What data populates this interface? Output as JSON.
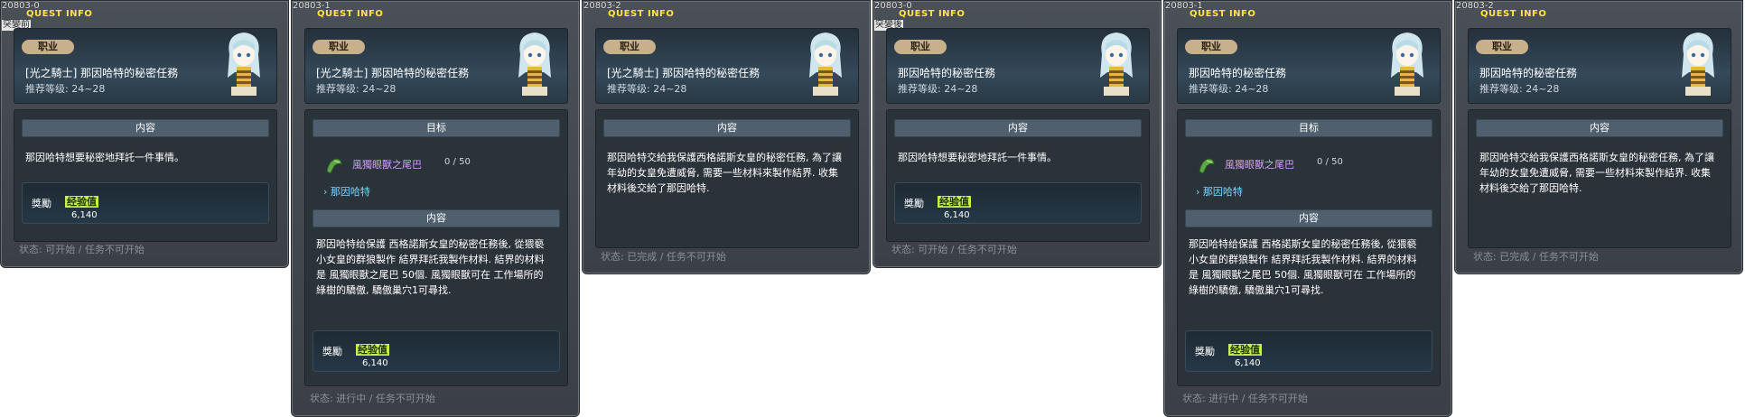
{
  "panels": [
    {
      "id": "20803-0",
      "title": "QUEST INFO",
      "sub_label": "突變前",
      "job_tag": "职业",
      "quest_name": "[光之騎士] 那因哈特的秘密任務",
      "level": "推荐等级: 24~28",
      "section_label": "内容",
      "description": "那因哈特想要秘密地拜託一件事情。",
      "reward_label": "獎勵",
      "reward_exp": "经验值",
      "reward_value": "6,140",
      "status": "状态: 可开始 / 任务不可开始"
    },
    {
      "id": "20803-1",
      "title": "QUEST INFO",
      "job_tag": "职业",
      "quest_name": "[光之騎士] 那因哈特的秘密任務",
      "level": "推荐等级: 24~28",
      "target_label": "目标",
      "target_item": "風獨眼獸之尾巴",
      "target_count": "0 / 50",
      "target_npc": "› 那因哈特",
      "section_label": "内容",
      "description": "那因哈特给保護 西格諾斯女皇的秘密任務後, 從猥褻小女皇的群狼製作 結界拜託我製作材料. 結界的材料是 風獨眼獸之尾巴 50個. 風獨眼獸可在 工作場所的 綠樹的驕傲, 驕傲巢穴1可尋找.",
      "reward_label": "獎勵",
      "reward_exp": "经验值",
      "reward_value": "6,140",
      "status": "状态: 进行中 / 任务不可开始"
    },
    {
      "id": "20803-2",
      "title": "QUEST INFO",
      "job_tag": "职业",
      "quest_name": "[光之騎士] 那因哈特的秘密任務",
      "level": "推荐等级: 24~28",
      "section_label": "内容",
      "description": "那因哈特交給我保護西格諾斯女皇的秘密任務, 為了讓年幼的女皇免遭威脅, 需要一些材料來製作結界. 收集材料後交給了那因哈特.",
      "status": "状态: 已完成 / 任务不可开始"
    },
    {
      "id": "20803-0",
      "title": "QUEST INFO",
      "sub_label": "突變後",
      "job_tag": "职业",
      "quest_name": "那因哈特的秘密任務",
      "level": "推荐等级: 24~28",
      "section_label": "内容",
      "description": "那因哈特想要秘密地拜託一件事情。",
      "reward_label": "獎勵",
      "reward_exp": "经验值",
      "reward_value": "6,140",
      "status": "状态: 可开始 / 任务不可开始"
    },
    {
      "id": "20803-1",
      "title": "QUEST INFO",
      "job_tag": "职业",
      "quest_name": "那因哈特的秘密任務",
      "level": "推荐等级: 24~28",
      "target_label": "目标",
      "target_item": "風獨眼獸之尾巴",
      "target_count": "0 / 50",
      "target_npc": "› 那因哈特",
      "section_label": "内容",
      "description": "那因哈特给保護 西格諾斯女皇的秘密任務後, 從猥褻小女皇的群狼製作 結界拜託我製作材料. 結界的材料是 風獨眼獸之尾巴 50個. 風獨眼獸可在 工作場所的 綠樹的驕傲, 驕傲巢穴1可尋找.",
      "reward_label": "獎勵",
      "reward_exp": "经验值",
      "reward_value": "6,140",
      "status": "状态: 进行中 / 任务不可开始"
    },
    {
      "id": "20803-2",
      "title": "QUEST INFO",
      "job_tag": "职业",
      "quest_name": "那因哈特的秘密任務",
      "level": "推荐等级: 24~28",
      "section_label": "内容",
      "description": "那因哈特交給我保護西格諾斯女皇的秘密任務, 為了讓年幼的女皇免遭威脅, 需要一些材料來製作結界. 收集材料後交給了那因哈特.",
      "status": "状态: 已完成 / 任务不可开始"
    }
  ]
}
